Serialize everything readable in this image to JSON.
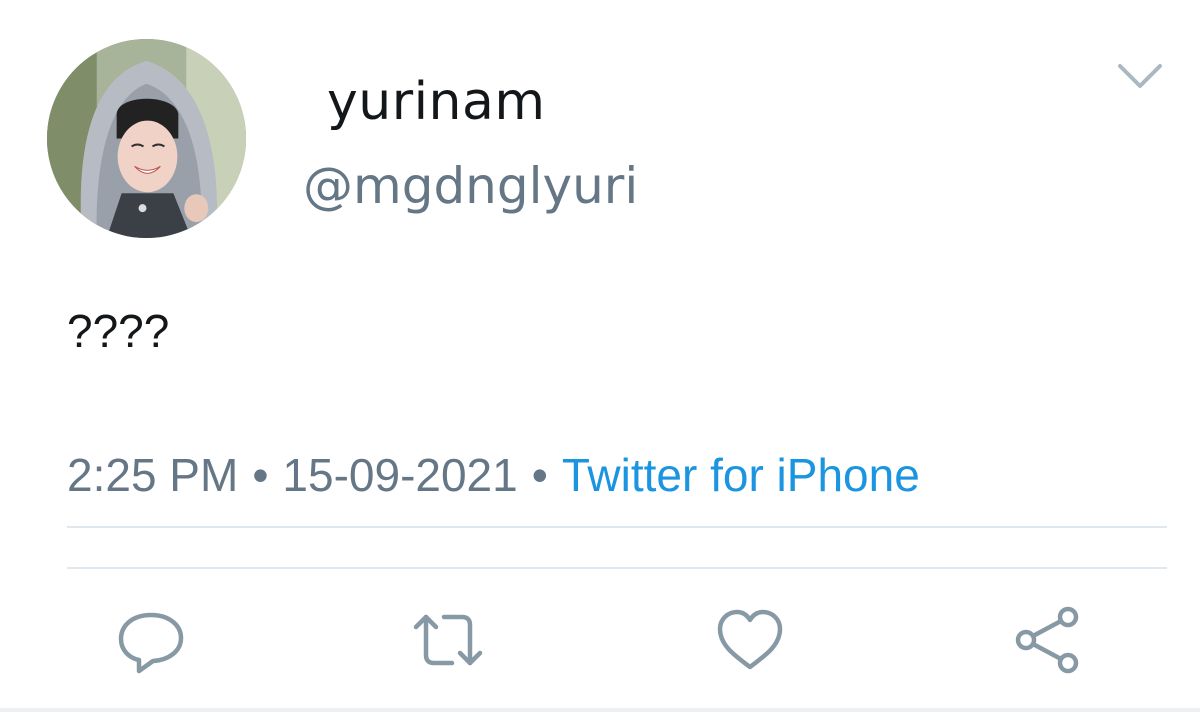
{
  "user": {
    "display_name": "yurinam",
    "handle": "@mgdnglyuri",
    "avatar_icon": "profile-photo"
  },
  "tweet": {
    "text": "????",
    "time": "2:25 PM",
    "date": "15-09-2021",
    "source": "Twitter for iPhone",
    "separator": "•"
  },
  "actions": {
    "reply_icon": "reply-icon",
    "retweet_icon": "retweet-icon",
    "like_icon": "heart-icon",
    "share_icon": "share-icon"
  },
  "colors": {
    "text_primary": "#14171a",
    "text_secondary": "#657786",
    "link": "#1b95e0",
    "icon": "#8899a6",
    "divider": "#e1e8ed"
  }
}
